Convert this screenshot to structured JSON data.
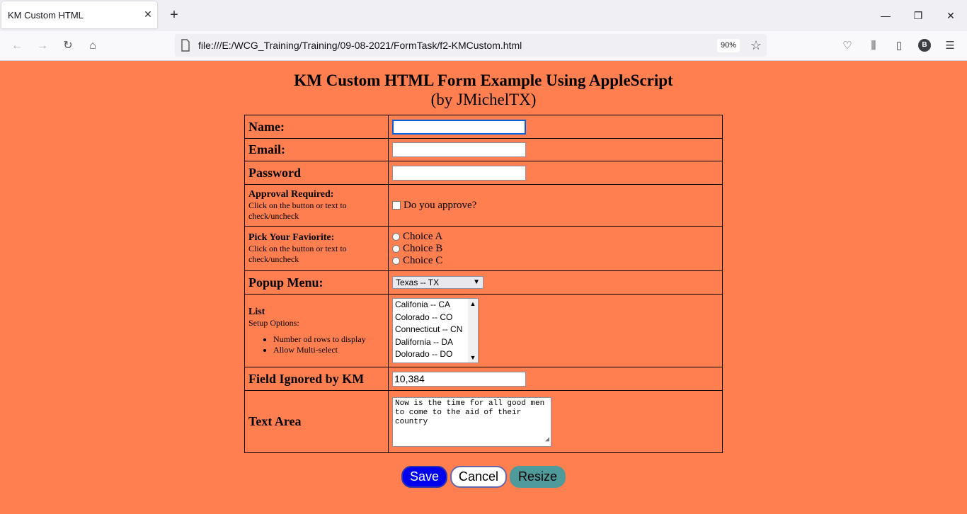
{
  "browser": {
    "tab_title": "KM Custom HTML",
    "url": "file:///E:/WCG_Training/Training/09-08-2021/FormTask/f2-KMCustom.html",
    "zoom": "90%",
    "avatar_letter": "B"
  },
  "page": {
    "title": "KM Custom HTML Form Example Using AppleScript",
    "subtitle": "(by JMichelTX)",
    "background_color": "#ff7f50"
  },
  "form": {
    "name_label": "Name:",
    "name_value": "",
    "email_label": "Email:",
    "email_value": "",
    "password_label": "Password",
    "password_value": "",
    "approval_label": "Approval Required:",
    "approval_note": "Click on the button or text to check/uncheck",
    "approval_option": "Do you approve?",
    "approval_checked": false,
    "pick_label": "Pick Your Faviorite:",
    "pick_note": "Click on the button or text to check/uncheck",
    "choices": [
      "Choice A",
      "Choice B",
      "Choice C"
    ],
    "popup_label": "Popup Menu:",
    "popup_value": "Texas -- TX",
    "list_label": "List",
    "list_note": "Setup Options:",
    "list_setup": [
      "Number od rows to display",
      "Allow Multi-select"
    ],
    "list_items": [
      "Califonia -- CA",
      "Colorado -- CO",
      "Connecticut -- CN",
      "Dalifornia -- DA",
      "Dolorado -- DO"
    ],
    "ignored_label": "Field Ignored by KM",
    "ignored_value": "10,384",
    "textarea_label": "Text Area",
    "textarea_value": "Now is the time for all good men to come to the aid of their country"
  },
  "buttons": {
    "save": "Save",
    "cancel": "Cancel",
    "resize": "Resize"
  }
}
